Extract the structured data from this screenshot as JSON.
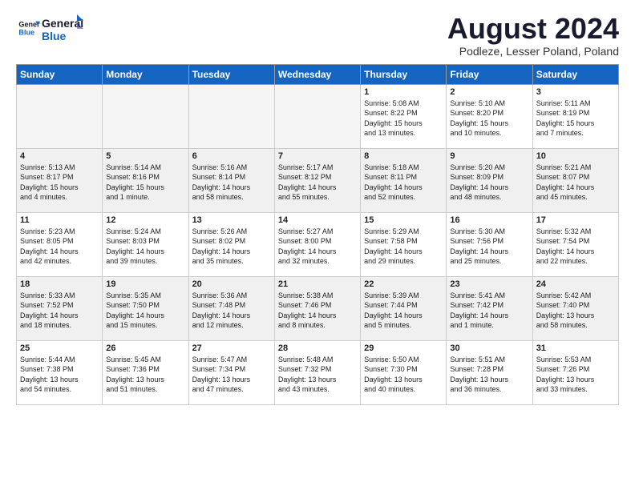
{
  "header": {
    "logo_general": "General",
    "logo_blue": "Blue",
    "month_title": "August 2024",
    "subtitle": "Podleze, Lesser Poland, Poland"
  },
  "days_of_week": [
    "Sunday",
    "Monday",
    "Tuesday",
    "Wednesday",
    "Thursday",
    "Friday",
    "Saturday"
  ],
  "weeks": [
    {
      "row_class": "row-even",
      "days": [
        {
          "num": "",
          "info": "",
          "empty": true
        },
        {
          "num": "",
          "info": "",
          "empty": true
        },
        {
          "num": "",
          "info": "",
          "empty": true
        },
        {
          "num": "",
          "info": "",
          "empty": true
        },
        {
          "num": "1",
          "info": "Sunrise: 5:08 AM\nSunset: 8:22 PM\nDaylight: 15 hours\nand 13 minutes.",
          "empty": false
        },
        {
          "num": "2",
          "info": "Sunrise: 5:10 AM\nSunset: 8:20 PM\nDaylight: 15 hours\nand 10 minutes.",
          "empty": false
        },
        {
          "num": "3",
          "info": "Sunrise: 5:11 AM\nSunset: 8:19 PM\nDaylight: 15 hours\nand 7 minutes.",
          "empty": false
        }
      ]
    },
    {
      "row_class": "row-odd",
      "days": [
        {
          "num": "4",
          "info": "Sunrise: 5:13 AM\nSunset: 8:17 PM\nDaylight: 15 hours\nand 4 minutes.",
          "empty": false
        },
        {
          "num": "5",
          "info": "Sunrise: 5:14 AM\nSunset: 8:16 PM\nDaylight: 15 hours\nand 1 minute.",
          "empty": false
        },
        {
          "num": "6",
          "info": "Sunrise: 5:16 AM\nSunset: 8:14 PM\nDaylight: 14 hours\nand 58 minutes.",
          "empty": false
        },
        {
          "num": "7",
          "info": "Sunrise: 5:17 AM\nSunset: 8:12 PM\nDaylight: 14 hours\nand 55 minutes.",
          "empty": false
        },
        {
          "num": "8",
          "info": "Sunrise: 5:18 AM\nSunset: 8:11 PM\nDaylight: 14 hours\nand 52 minutes.",
          "empty": false
        },
        {
          "num": "9",
          "info": "Sunrise: 5:20 AM\nSunset: 8:09 PM\nDaylight: 14 hours\nand 48 minutes.",
          "empty": false
        },
        {
          "num": "10",
          "info": "Sunrise: 5:21 AM\nSunset: 8:07 PM\nDaylight: 14 hours\nand 45 minutes.",
          "empty": false
        }
      ]
    },
    {
      "row_class": "row-even",
      "days": [
        {
          "num": "11",
          "info": "Sunrise: 5:23 AM\nSunset: 8:05 PM\nDaylight: 14 hours\nand 42 minutes.",
          "empty": false
        },
        {
          "num": "12",
          "info": "Sunrise: 5:24 AM\nSunset: 8:03 PM\nDaylight: 14 hours\nand 39 minutes.",
          "empty": false
        },
        {
          "num": "13",
          "info": "Sunrise: 5:26 AM\nSunset: 8:02 PM\nDaylight: 14 hours\nand 35 minutes.",
          "empty": false
        },
        {
          "num": "14",
          "info": "Sunrise: 5:27 AM\nSunset: 8:00 PM\nDaylight: 14 hours\nand 32 minutes.",
          "empty": false
        },
        {
          "num": "15",
          "info": "Sunrise: 5:29 AM\nSunset: 7:58 PM\nDaylight: 14 hours\nand 29 minutes.",
          "empty": false
        },
        {
          "num": "16",
          "info": "Sunrise: 5:30 AM\nSunset: 7:56 PM\nDaylight: 14 hours\nand 25 minutes.",
          "empty": false
        },
        {
          "num": "17",
          "info": "Sunrise: 5:32 AM\nSunset: 7:54 PM\nDaylight: 14 hours\nand 22 minutes.",
          "empty": false
        }
      ]
    },
    {
      "row_class": "row-odd",
      "days": [
        {
          "num": "18",
          "info": "Sunrise: 5:33 AM\nSunset: 7:52 PM\nDaylight: 14 hours\nand 18 minutes.",
          "empty": false
        },
        {
          "num": "19",
          "info": "Sunrise: 5:35 AM\nSunset: 7:50 PM\nDaylight: 14 hours\nand 15 minutes.",
          "empty": false
        },
        {
          "num": "20",
          "info": "Sunrise: 5:36 AM\nSunset: 7:48 PM\nDaylight: 14 hours\nand 12 minutes.",
          "empty": false
        },
        {
          "num": "21",
          "info": "Sunrise: 5:38 AM\nSunset: 7:46 PM\nDaylight: 14 hours\nand 8 minutes.",
          "empty": false
        },
        {
          "num": "22",
          "info": "Sunrise: 5:39 AM\nSunset: 7:44 PM\nDaylight: 14 hours\nand 5 minutes.",
          "empty": false
        },
        {
          "num": "23",
          "info": "Sunrise: 5:41 AM\nSunset: 7:42 PM\nDaylight: 14 hours\nand 1 minute.",
          "empty": false
        },
        {
          "num": "24",
          "info": "Sunrise: 5:42 AM\nSunset: 7:40 PM\nDaylight: 13 hours\nand 58 minutes.",
          "empty": false
        }
      ]
    },
    {
      "row_class": "row-even",
      "days": [
        {
          "num": "25",
          "info": "Sunrise: 5:44 AM\nSunset: 7:38 PM\nDaylight: 13 hours\nand 54 minutes.",
          "empty": false
        },
        {
          "num": "26",
          "info": "Sunrise: 5:45 AM\nSunset: 7:36 PM\nDaylight: 13 hours\nand 51 minutes.",
          "empty": false
        },
        {
          "num": "27",
          "info": "Sunrise: 5:47 AM\nSunset: 7:34 PM\nDaylight: 13 hours\nand 47 minutes.",
          "empty": false
        },
        {
          "num": "28",
          "info": "Sunrise: 5:48 AM\nSunset: 7:32 PM\nDaylight: 13 hours\nand 43 minutes.",
          "empty": false
        },
        {
          "num": "29",
          "info": "Sunrise: 5:50 AM\nSunset: 7:30 PM\nDaylight: 13 hours\nand 40 minutes.",
          "empty": false
        },
        {
          "num": "30",
          "info": "Sunrise: 5:51 AM\nSunset: 7:28 PM\nDaylight: 13 hours\nand 36 minutes.",
          "empty": false
        },
        {
          "num": "31",
          "info": "Sunrise: 5:53 AM\nSunset: 7:26 PM\nDaylight: 13 hours\nand 33 minutes.",
          "empty": false
        }
      ]
    }
  ]
}
